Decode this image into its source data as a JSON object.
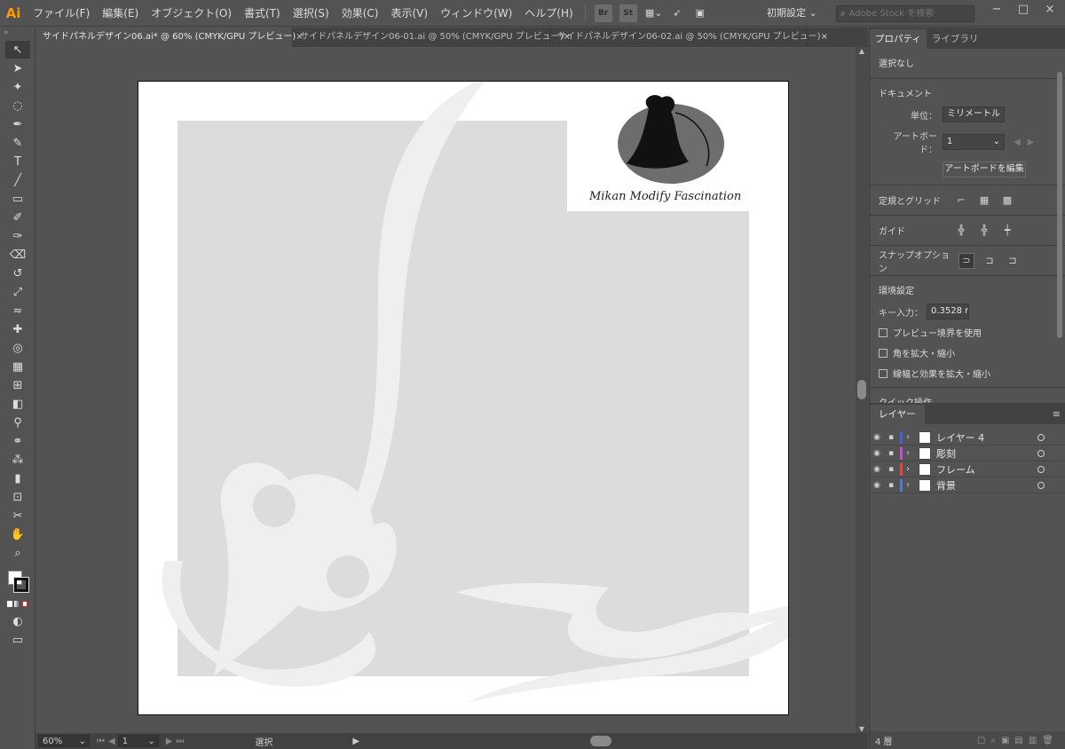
{
  "app": {
    "logo": "Ai"
  },
  "menu": [
    "ファイル(F)",
    "編集(E)",
    "オブジェクト(O)",
    "書式(T)",
    "選択(S)",
    "効果(C)",
    "表示(V)",
    "ウィンドウ(W)",
    "ヘルプ(H)"
  ],
  "app_icons": [
    "Br",
    "St"
  ],
  "workspace": {
    "label": "初期設定 ⌄"
  },
  "stock_search": {
    "placeholder": "Adobe Stock を検索"
  },
  "window_controls": {
    "minimize": "−",
    "restore": "□",
    "close": "×"
  },
  "tabs": [
    {
      "label": "サイドパネルデザイン06.ai* @ 60% (CMYK/GPU プレビュー)",
      "close": "×"
    },
    {
      "label": "サイドパネルデザイン06-01.ai @ 50% (CMYK/GPU プレビュー)",
      "close": "×"
    },
    {
      "label": "サイドパネルデザイン06-02.ai @ 50% (CMYK/GPU プレビュー)",
      "close": "×"
    }
  ],
  "tools": [
    {
      "name": "selection-tool",
      "glyph": "↖"
    },
    {
      "name": "direct-selection-tool",
      "glyph": "➤"
    },
    {
      "name": "magic-wand-tool",
      "glyph": "✦"
    },
    {
      "name": "lasso-tool",
      "glyph": "◌"
    },
    {
      "name": "pen-tool",
      "glyph": "✒"
    },
    {
      "name": "curvature-tool",
      "glyph": "✎"
    },
    {
      "name": "type-tool",
      "glyph": "T"
    },
    {
      "name": "line-tool",
      "glyph": "╱"
    },
    {
      "name": "rectangle-tool",
      "glyph": "▭"
    },
    {
      "name": "paintbrush-tool",
      "glyph": "✐"
    },
    {
      "name": "shaper-tool",
      "glyph": "✑"
    },
    {
      "name": "eraser-tool",
      "glyph": "⌫"
    },
    {
      "name": "rotate-tool",
      "glyph": "↺"
    },
    {
      "name": "scale-tool",
      "glyph": "⤢"
    },
    {
      "name": "warp-tool",
      "glyph": "≈"
    },
    {
      "name": "puppet-warp-tool",
      "glyph": "✚"
    },
    {
      "name": "shape-builder-tool",
      "glyph": "◎"
    },
    {
      "name": "perspective-grid-tool",
      "glyph": "▦"
    },
    {
      "name": "mesh-tool",
      "glyph": "⊞"
    },
    {
      "name": "gradient-tool",
      "glyph": "◧"
    },
    {
      "name": "eyedropper-tool",
      "glyph": "⚲"
    },
    {
      "name": "blend-tool",
      "glyph": "⚭"
    },
    {
      "name": "symbol-sprayer-tool",
      "glyph": "⁂"
    },
    {
      "name": "column-graph-tool",
      "glyph": "▮"
    },
    {
      "name": "artboard-tool",
      "glyph": "⊡"
    },
    {
      "name": "slice-tool",
      "glyph": "✂"
    },
    {
      "name": "hand-tool",
      "glyph": "✋"
    },
    {
      "name": "zoom-tool",
      "glyph": "⌕"
    }
  ],
  "artwork": {
    "logo_text": "Mikan Modify Fascination"
  },
  "status": {
    "zoom": "60%",
    "artboard": "1",
    "tool": "選択"
  },
  "properties": {
    "tabs": [
      "プロパティ",
      "ライブラリ"
    ],
    "selection": "選択なし",
    "document": {
      "title": "ドキュメント",
      "unit_label": "単位：",
      "unit_value": "ミリメートル",
      "artboard_label": "アートボード：",
      "artboard_value": "1",
      "edit_button": "アートボードを編集"
    },
    "rulers_grids": "定規とグリッド",
    "guides": "ガイド",
    "snap_options": "スナップオプション",
    "preferences": {
      "title": "環境設定",
      "key_increment_label": "キー入力：",
      "key_increment_value": "0.3528 m",
      "checkboxes": [
        "プレビュー境界を使用",
        "角を拡大・縮小",
        "線幅と効果を拡大・縮小"
      ]
    },
    "quick_actions": "クイック操作"
  },
  "layers": {
    "tab": "レイヤー",
    "items": [
      {
        "name": "レイヤー 4",
        "color": "#4f5bd5"
      },
      {
        "name": "彫刻",
        "color": "#c34fd5"
      },
      {
        "name": "フレーム",
        "color": "#e0483c"
      },
      {
        "name": "背景",
        "color": "#4f7ad5"
      }
    ],
    "count": "4 層"
  }
}
